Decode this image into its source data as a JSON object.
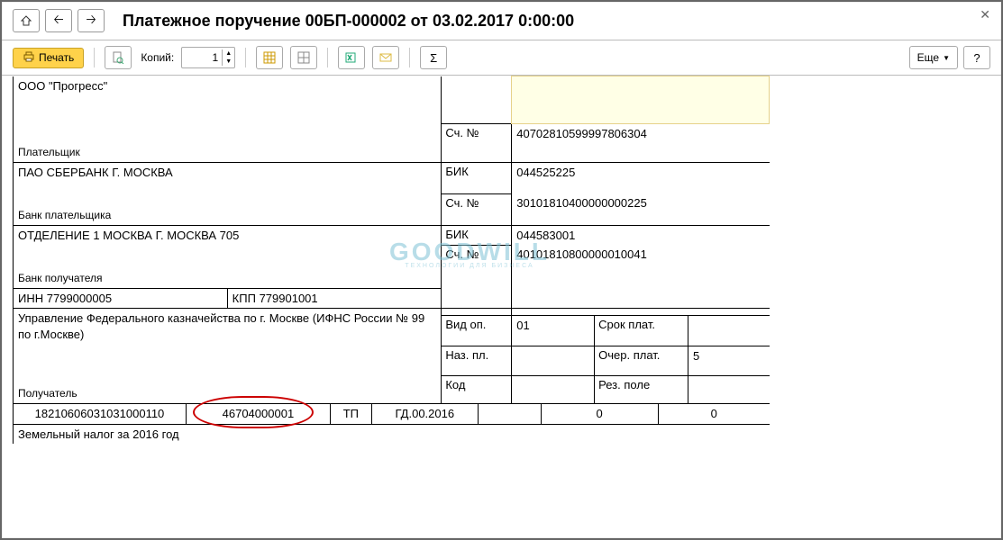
{
  "window": {
    "title": "Платежное поручение 00БП-000002 от 03.02.2017 0:00:00"
  },
  "toolbar": {
    "print_label": "Печать",
    "copies_label": "Копий:",
    "copies_value": "1",
    "more_label": "Еще"
  },
  "watermark": {
    "main": "GOODWILL",
    "sub": "ТЕХНОЛОГИИ ДЛЯ БИЗНЕСА"
  },
  "doc": {
    "payer_name": "ООО \"Прогресс\"",
    "payer_caption": "Плательщик",
    "payer_account_label": "Сч. №",
    "payer_account": "40702810599997806304",
    "payer_bank": "ПАО СБЕРБАНК Г. МОСКВА",
    "payer_bank_caption": "Банк плательщика",
    "bic_label": "БИК",
    "payer_bic": "044525225",
    "payer_bank_account": "30101810400000000225",
    "rec_bank": "ОТДЕЛЕНИЕ 1 МОСКВА Г. МОСКВА 705",
    "rec_bank_caption": "Банк получателя",
    "rec_bic": "044583001",
    "inn_label": "ИНН",
    "inn_value": "7799000005",
    "kpp_label": "КПП",
    "kpp_value": "779901001",
    "rec_account": "40101810800000010041",
    "recipient": "Управление Федерального казначейства по г. Москве (ИФНС России № 99 по г.Москве)",
    "recipient_caption": "Получатель",
    "vid_op_label": "Вид оп.",
    "vid_op_value": "01",
    "srok_label": "Срок плат.",
    "naz_label": "Наз. пл.",
    "ocher_label": "Очер. плат.",
    "ocher_value": "5",
    "kod_label": "Код",
    "rez_label": "Рез. поле",
    "row": {
      "kbk": "18210606031031000110",
      "oktmo": "46704000001",
      "tp": "ТП",
      "period": "ГД.00.2016",
      "z1": "0",
      "z2": "0"
    },
    "purpose": "Земельный налог за 2016 год"
  }
}
